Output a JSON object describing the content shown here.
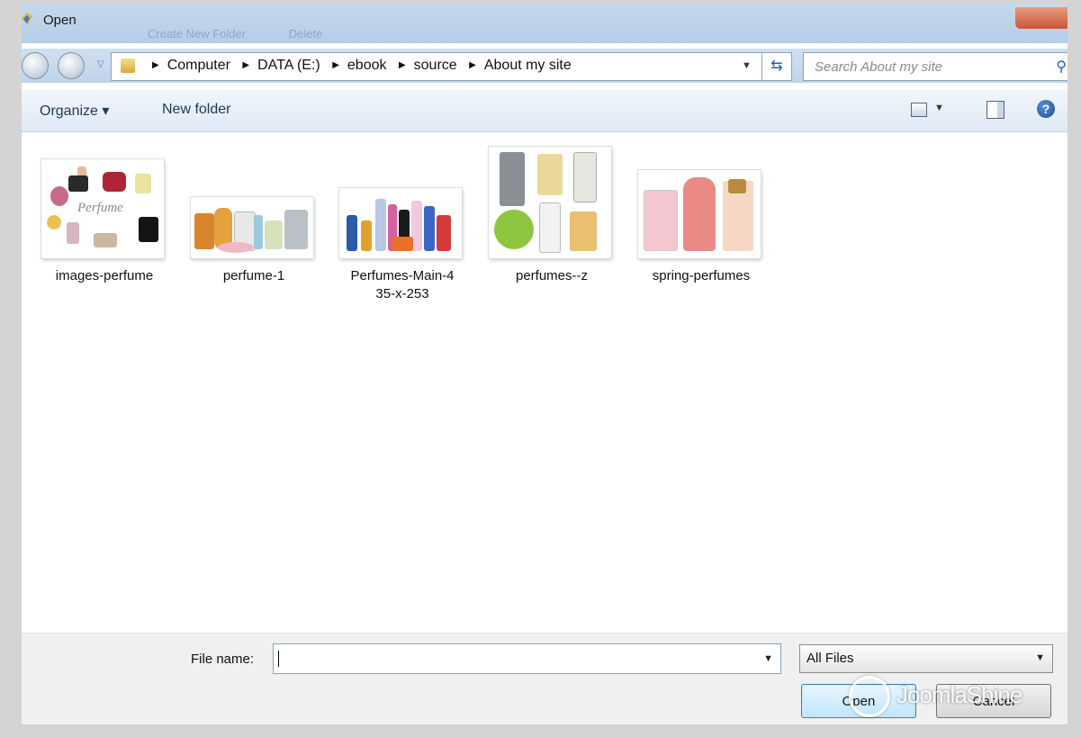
{
  "window": {
    "title": "Open",
    "faded_toolbar": [
      "Create New Folder",
      "Delete"
    ]
  },
  "nav": {
    "back_icon": "back-arrow-icon",
    "forward_icon": "forward-arrow-icon",
    "breadcrumbs": [
      "Computer",
      "DATA (E:)",
      "ebook",
      "source",
      "About my site"
    ],
    "search_placeholder": "Search About my site"
  },
  "toolbar": {
    "organize": "Organize ▾",
    "new_folder": "New folder"
  },
  "files": [
    {
      "name": "images-perfume"
    },
    {
      "name": "perfume-1"
    },
    {
      "name": "Perfumes-Main-4\n35-x-253",
      "line1": "Perfumes-Main-4",
      "line2": "35-x-253"
    },
    {
      "name": "perfumes--z"
    },
    {
      "name": "spring-perfumes"
    }
  ],
  "footer": {
    "file_name_label": "File name:",
    "file_name_value": "",
    "file_type": "All Files",
    "open_label": "Open",
    "cancel_label": "Cancel"
  },
  "watermark": "JoomlaShine"
}
